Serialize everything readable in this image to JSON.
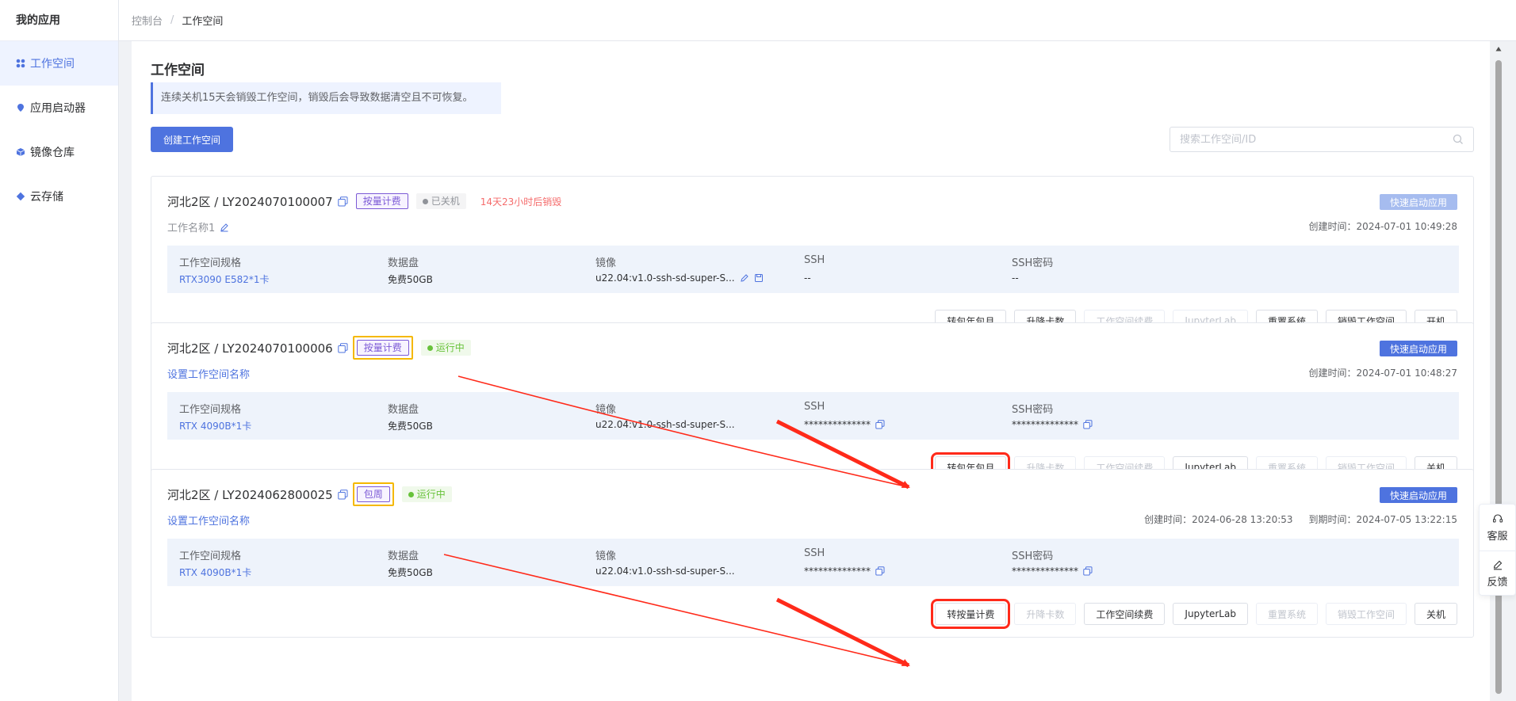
{
  "sidebar": {
    "title": "我的应用",
    "items": [
      {
        "label": "工作空间",
        "icon": "grid-icon",
        "active": true
      },
      {
        "label": "应用启动器",
        "icon": "pin-icon",
        "active": false
      },
      {
        "label": "镜像仓库",
        "icon": "cube-icon",
        "active": false
      },
      {
        "label": "云存储",
        "icon": "cloud-icon",
        "active": false
      }
    ]
  },
  "breadcrumb": {
    "root": "控制台",
    "separator": "/",
    "current": "工作空间"
  },
  "page": {
    "title": "工作空间",
    "notice": "连续关机15天会销毁工作空间，销毁后会导致数据清空且不可恢复。",
    "create_label": "创建工作空间",
    "search_placeholder": "搜索工作空间/ID",
    "search_value": ""
  },
  "columns": {
    "spec": "工作空间规格",
    "disk": "数据盘",
    "image": "镜像",
    "ssh": "SSH",
    "ssh_pwd": "SSH密码"
  },
  "quick_label": "快速启动应用",
  "workspaces": [
    {
      "name": "河北2区 / LY2024070100007",
      "billing": "按量计费",
      "status": "已关机",
      "countdown": "14天23小时后销毁",
      "subtitle": "工作名称1",
      "created": "创建时间：2024-07-01 10:49:28",
      "expires": "",
      "spec": "RTX3090 E582*1卡",
      "disk": "免费50GB",
      "image": "u22.04:v1.0-ssh-sd-super-S...",
      "ssh": "--",
      "ssh_pwd": "--",
      "actions": [
        {
          "label": "转包年包月",
          "disabled": false
        },
        {
          "label": "升降卡数",
          "disabled": false
        },
        {
          "label": "工作空间续费",
          "disabled": true
        },
        {
          "label": "JupyterLab",
          "disabled": true
        },
        {
          "label": "重置系统",
          "disabled": false
        },
        {
          "label": "销毁工作空间",
          "disabled": false
        },
        {
          "label": "开机",
          "disabled": false
        }
      ]
    },
    {
      "name": "河北2区 / LY2024070100006",
      "billing": "按量计费",
      "status": "运行中",
      "countdown": "",
      "subtitle": "设置工作空间名称",
      "created": "创建时间：2024-07-01 10:48:27",
      "expires": "",
      "spec": "RTX 4090B*1卡",
      "disk": "免费50GB",
      "image": "u22.04:v1.0-ssh-sd-super-S...",
      "ssh": "**************",
      "ssh_pwd": "**************",
      "actions": [
        {
          "label": "转包年包月",
          "disabled": false
        },
        {
          "label": "升降卡数",
          "disabled": true
        },
        {
          "label": "工作空间续费",
          "disabled": true
        },
        {
          "label": "JupyterLab",
          "disabled": false
        },
        {
          "label": "重置系统",
          "disabled": true
        },
        {
          "label": "销毁工作空间",
          "disabled": true
        },
        {
          "label": "关机",
          "disabled": false
        }
      ]
    },
    {
      "name": "河北2区 / LY2024062800025",
      "billing": "包周",
      "status": "运行中",
      "countdown": "",
      "subtitle": "设置工作空间名称",
      "created": "创建时间：2024-06-28 13:20:53",
      "expires": "到期时间：2024-07-05 13:22:15",
      "spec": "RTX 4090B*1卡",
      "disk": "免费50GB",
      "image": "u22.04:v1.0-ssh-sd-super-S...",
      "ssh": "**************",
      "ssh_pwd": "**************",
      "actions": [
        {
          "label": "转按量计费",
          "disabled": false
        },
        {
          "label": "升降卡数",
          "disabled": true
        },
        {
          "label": "工作空间续费",
          "disabled": false
        },
        {
          "label": "JupyterLab",
          "disabled": false
        },
        {
          "label": "重置系统",
          "disabled": true
        },
        {
          "label": "销毁工作空间",
          "disabled": true
        },
        {
          "label": "关机",
          "disabled": false
        }
      ]
    }
  ],
  "float_panel": {
    "service": "客服",
    "feedback": "反馈"
  },
  "colors": {
    "primary": "#4e73df",
    "running": "#67c23a",
    "danger": "#f56c6c",
    "highlight_red": "#ff2a1a",
    "highlight_yellow": "#f5b800",
    "billing_tag": "#7c5ad6"
  }
}
